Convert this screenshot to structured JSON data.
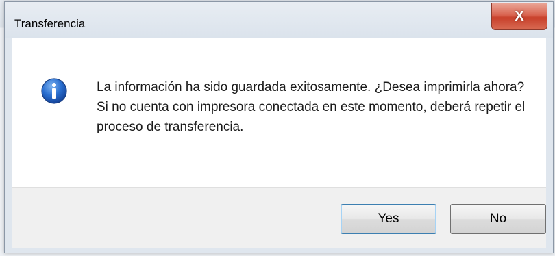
{
  "window": {
    "title": "Transferencia",
    "close_symbol": "X"
  },
  "message": {
    "icon": "info-icon",
    "lines": [
      "La información ha sido guardada exitosamente. ¿Desea imprimirla ahora?",
      "Si no cuenta con impresora conectada en este momento, deberá repetir el proceso de transferencia."
    ]
  },
  "buttons": {
    "yes_label": "Yes",
    "no_label": "No"
  },
  "colors": {
    "close_button": "#c8402b",
    "info_icon": "#1f5fbf",
    "default_button_border": "#3c7fb1"
  }
}
